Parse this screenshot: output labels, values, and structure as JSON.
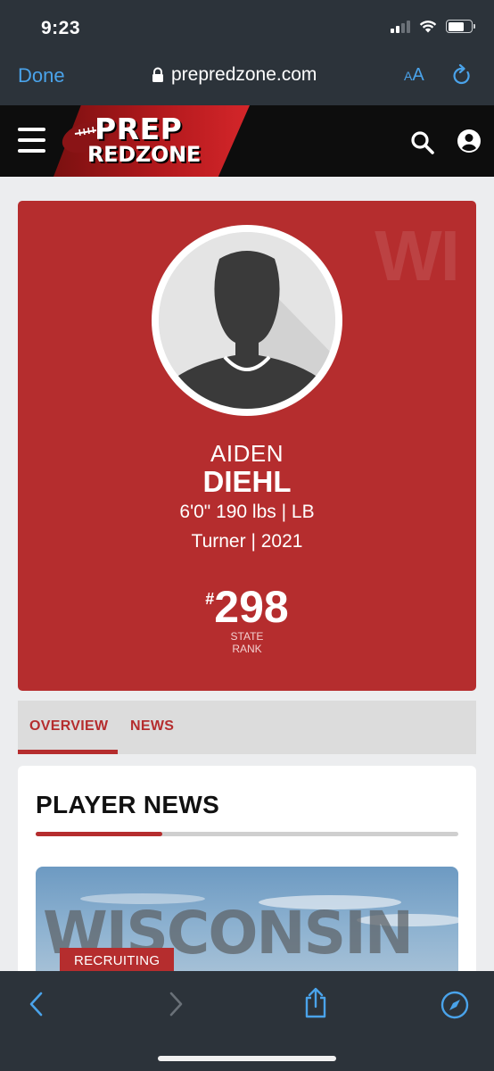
{
  "status_bar": {
    "time": "9:23"
  },
  "safari": {
    "done_label": "Done",
    "url": "prepredzone.com",
    "aa_label_small": "A",
    "aa_label_large": "A"
  },
  "site": {
    "logo_line1": "PREP",
    "logo_line2": "REDZONE"
  },
  "profile": {
    "state_watermark": "WI",
    "first_name": "AIDEN",
    "last_name": "DIEHL",
    "measurables": "6'0\" 190 lbs | LB",
    "school_year": "Turner | 2021",
    "rank_hash": "#",
    "rank_number": "298",
    "rank_label_line1": "STATE",
    "rank_label_line2": "RANK"
  },
  "tabs": [
    {
      "label": "OVERVIEW",
      "active": true
    },
    {
      "label": "NEWS",
      "active": false
    }
  ],
  "news": {
    "title": "PLAYER NEWS",
    "image_text": "WISCONSIN",
    "tag": "RECRUITING"
  },
  "colors": {
    "brand_red": "#b52d2e",
    "safari_bg": "#2c333a",
    "safari_blue": "#4aa3ea"
  }
}
